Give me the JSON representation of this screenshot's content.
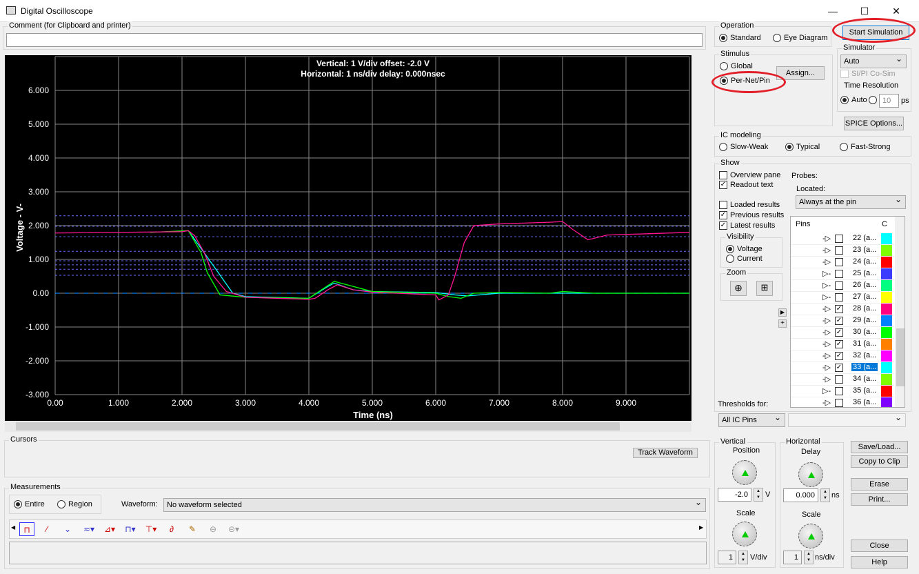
{
  "window": {
    "title": "Digital Oscilloscope",
    "minimize": "—",
    "maximize": "☐",
    "close": "✕"
  },
  "comment": {
    "label": "Comment (for Clipboard and printer)",
    "value": ""
  },
  "scope": {
    "header_vertical": "Vertical: 1  V/div  offset: -2.0 V",
    "header_horizontal": "Horizontal: 1 ns/div  delay: 0.000nsec",
    "ylabel": "Voltage  - V-",
    "xlabel": "Time  (ns)",
    "yticks": [
      "6.000",
      "5.000",
      "4.000",
      "3.000",
      "2.000",
      "1.000",
      "0.00",
      "-1.000",
      "-2.000",
      "-3.000"
    ],
    "xticks": [
      "0.00",
      "1.000",
      "2.000",
      "3.000",
      "4.000",
      "5.000",
      "6.000",
      "7.000",
      "8.000",
      "9.000"
    ],
    "thresholds_v": [
      2.29,
      1.98,
      1.67,
      1.24,
      0.96,
      0.84,
      0.71,
      0.53
    ],
    "traces": [
      {
        "pin": "28",
        "color": "#ff1493",
        "points": [
          [
            0,
            1.78
          ],
          [
            2.0,
            1.82
          ],
          [
            2.1,
            1.85
          ],
          [
            2.2,
            1.7
          ],
          [
            2.35,
            1.2
          ],
          [
            2.5,
            0.5
          ],
          [
            2.7,
            0.05
          ],
          [
            3.0,
            -0.12
          ],
          [
            4.0,
            -0.18
          ],
          [
            4.1,
            -0.15
          ],
          [
            4.3,
            0.1
          ],
          [
            4.45,
            0.25
          ],
          [
            4.7,
            0.1
          ],
          [
            5.0,
            0.03
          ],
          [
            6.0,
            -0.05
          ],
          [
            6.05,
            -0.2
          ],
          [
            6.2,
            -0.05
          ],
          [
            6.3,
            0.5
          ],
          [
            6.45,
            1.5
          ],
          [
            6.6,
            2.0
          ],
          [
            7.0,
            2.05
          ],
          [
            7.8,
            2.1
          ],
          [
            8.0,
            2.12
          ],
          [
            8.15,
            1.9
          ],
          [
            8.4,
            1.58
          ],
          [
            8.7,
            1.72
          ],
          [
            10,
            1.8
          ]
        ]
      },
      {
        "pin": "30",
        "color": "#00ff00",
        "points": [
          [
            1.5,
            1.8
          ],
          [
            2.1,
            1.85
          ],
          [
            2.3,
            1.2
          ],
          [
            2.4,
            0.6
          ],
          [
            2.6,
            -0.05
          ],
          [
            3.0,
            -0.12
          ],
          [
            4.0,
            -0.15
          ],
          [
            4.2,
            0.1
          ],
          [
            4.4,
            0.35
          ],
          [
            4.6,
            0.25
          ],
          [
            5.0,
            0.05
          ],
          [
            6.0,
            0.0
          ],
          [
            6.2,
            -0.1
          ],
          [
            6.4,
            -0.15
          ],
          [
            6.6,
            0.0
          ],
          [
            7.0,
            0.02
          ],
          [
            7.8,
            0.0
          ],
          [
            8.0,
            0.05
          ],
          [
            8.5,
            0.0
          ],
          [
            10,
            0
          ]
        ]
      },
      {
        "pin": "33",
        "color": "#00ffff",
        "points": [
          [
            2.1,
            1.85
          ],
          [
            2.5,
            0.8
          ],
          [
            2.8,
            0.0
          ],
          [
            3.0,
            -0.1
          ],
          [
            4.0,
            -0.15
          ],
          [
            4.3,
            0.2
          ],
          [
            4.4,
            0.3
          ],
          [
            4.7,
            0.1
          ],
          [
            5.0,
            0.05
          ],
          [
            6.0,
            0.02
          ],
          [
            6.3,
            -0.05
          ],
          [
            6.5,
            -0.08
          ],
          [
            7,
            0
          ],
          [
            10,
            0
          ]
        ]
      },
      {
        "pin": "29",
        "color": "#0080ff",
        "points": [
          [
            0,
            0
          ],
          [
            10,
            0
          ]
        ]
      }
    ]
  },
  "operation": {
    "label": "Operation",
    "standard": "Standard",
    "eye": "Eye Diagram",
    "start": "Start Simulation"
  },
  "stimulus": {
    "label": "Stimulus",
    "global": "Global",
    "pernet": "Per-Net/Pin",
    "assign": "Assign..."
  },
  "simulator": {
    "label": "Simulator",
    "value": "Auto",
    "cosim": "SI/PI Co-Sim",
    "time_res": "Time Resolution",
    "auto": "Auto",
    "ps_value": "10",
    "ps": "ps",
    "spice": "SPICE Options..."
  },
  "ic": {
    "label": "IC modeling",
    "slow": "Slow-Weak",
    "typical": "Typical",
    "fast": "Fast-Strong"
  },
  "show": {
    "label": "Show",
    "overview": "Overview pane",
    "readout": "Readout text",
    "loaded": "Loaded results",
    "previous": "Previous results",
    "latest": "Latest results",
    "visibility": "Visibility",
    "voltage": "Voltage",
    "current": "Current",
    "zoom": "Zoom",
    "probes": "Probes:",
    "located": "Located:",
    "located_value": "Always at the pin"
  },
  "pins": {
    "header": "Pins",
    "col2": "C",
    "rows": [
      {
        "label": "22 (a...",
        "color": "#00ffff",
        "checked": false,
        "drv": "-▷"
      },
      {
        "label": "23 (a...",
        "color": "#80ff00",
        "checked": false,
        "drv": "-▷"
      },
      {
        "label": "24 (a...",
        "color": "#ff0000",
        "checked": false,
        "drv": "-▷"
      },
      {
        "label": "25 (a...",
        "color": "#3c3cff",
        "checked": false,
        "drv": "▷-"
      },
      {
        "label": "26 (a...",
        "color": "#00ff80",
        "checked": false,
        "drv": "▷-"
      },
      {
        "label": "27 (a...",
        "color": "#ffff00",
        "checked": false,
        "drv": "▷-"
      },
      {
        "label": "28 (a...",
        "color": "#ff0080",
        "checked": true,
        "drv": "-▷"
      },
      {
        "label": "29 (a...",
        "color": "#0080ff",
        "checked": true,
        "drv": "-▷"
      },
      {
        "label": "30 (a...",
        "color": "#00ff00",
        "checked": true,
        "drv": "-▷"
      },
      {
        "label": "31 (a...",
        "color": "#ff8000",
        "checked": true,
        "drv": "-▷"
      },
      {
        "label": "32 (a...",
        "color": "#ff00ff",
        "checked": true,
        "drv": "-▷"
      },
      {
        "label": "33 (a...",
        "color": "#00ffff",
        "checked": true,
        "drv": "-▷",
        "selected": true
      },
      {
        "label": "34 (a...",
        "color": "#80ff00",
        "checked": false,
        "drv": "-▷"
      },
      {
        "label": "35 (a...",
        "color": "#ff0000",
        "checked": false,
        "drv": "▷-"
      },
      {
        "label": "36 (a...",
        "color": "#8000ff",
        "checked": false,
        "drv": "-▷"
      }
    ]
  },
  "thresholds": {
    "label": "Thresholds for:",
    "value": "All IC Pins",
    "value2": ""
  },
  "cursors": {
    "label": "Cursors",
    "track": "Track Waveform"
  },
  "measurements": {
    "label": "Measurements",
    "entire": "Entire",
    "region": "Region",
    "waveform_label": "Waveform:",
    "waveform_value": "No waveform selected"
  },
  "vertical": {
    "label": "Vertical",
    "position": "Position",
    "pos_value": "-2.0",
    "unit": "V",
    "scale": "Scale",
    "scale_value": "1",
    "scale_unit": "V/div"
  },
  "horizontal": {
    "label": "Horizontal",
    "delay": "Delay",
    "delay_value": "0.000",
    "unit": "ns",
    "scale": "Scale",
    "scale_value": "1",
    "scale_unit": "ns/div"
  },
  "buttons": {
    "save": "Save/Load...",
    "copy": "Copy to Clip",
    "erase": "Erase",
    "print": "Print...",
    "close": "Close",
    "help": "Help"
  }
}
